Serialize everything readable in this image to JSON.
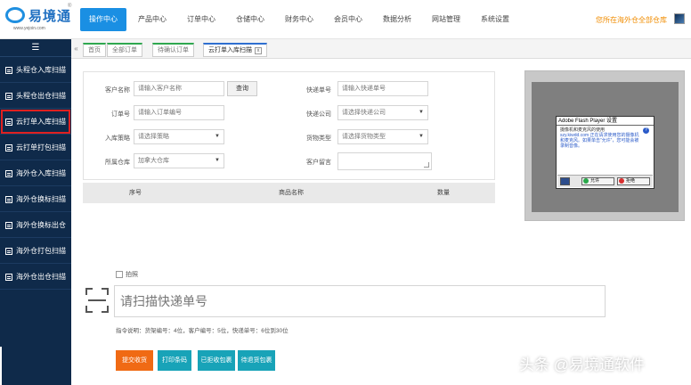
{
  "logo": {
    "name": "易境通",
    "reg": "®",
    "url": "www.yejoin.com"
  },
  "nav": {
    "items": [
      "操作中心",
      "产品中心",
      "订单中心",
      "仓储中心",
      "财务中心",
      "会员中心",
      "数据分析",
      "网站管理",
      "系统设置"
    ],
    "active_index": 0,
    "user_link": "您所在海外仓全部仓库"
  },
  "sidebar": {
    "toggle": "☰",
    "items": [
      "头程仓入库扫描",
      "头程仓出仓扫描",
      "云打单入库扫描",
      "云打单打包扫描",
      "海外仓入库扫描",
      "海外仓换标扫描",
      "海外仓换标出仓",
      "海外仓打包扫描",
      "海外仓出仓扫描"
    ],
    "selected_index": 2
  },
  "tabs": {
    "back": "«",
    "items": [
      "首页",
      "全部订单",
      "待确认订单",
      "云打单入库扫描"
    ],
    "close": "x"
  },
  "form": {
    "customer_name": {
      "label": "客户名称",
      "placeholder": "请输入客户名称"
    },
    "query_button": "查询",
    "order_no": {
      "label": "订单号",
      "placeholder": "请输入订单编号"
    },
    "inbound_strategy": {
      "label": "入库策略",
      "value": "请选择策略"
    },
    "warehouse": {
      "label": "所属仓库",
      "value": "加拿大仓库"
    },
    "express_no": {
      "label": "快递单号",
      "placeholder": "请输入快递单号"
    },
    "express_company": {
      "label": "快递公司",
      "value": "请选择快递公司"
    },
    "goods_type": {
      "label": "货物类型",
      "value": "请选择货物类型"
    },
    "customer_note": {
      "label": "客户留言"
    }
  },
  "table": {
    "columns": [
      "序号",
      "商品名称",
      "数量"
    ]
  },
  "flash_dialog": {
    "title": "Adobe Flash Player 设置",
    "text_line1": "摄像机和麦克风的使用",
    "text_line2": "szy.kiwdd.com 正在请求使用您的摄像机和麦克风。如果单击“允许”，您可能会被录制音像。",
    "allow": "允许",
    "deny": "拒绝",
    "help": "?"
  },
  "scan": {
    "photo_label": "拍照",
    "placeholder": "请扫描快递单号",
    "hint": "指令说明：货架编号：4位，客户编号：5位，快递单号：6位到30位"
  },
  "actions": [
    {
      "label": "提交收货",
      "color": "#f06a14"
    },
    {
      "label": "打印条码",
      "color": "#18a3b8"
    },
    {
      "label": "已拒收包裹",
      "color": "#18a3b8"
    },
    {
      "label": "待退货包裹",
      "color": "#18a3b8"
    }
  ],
  "watermark": "头条 @易境通软件"
}
